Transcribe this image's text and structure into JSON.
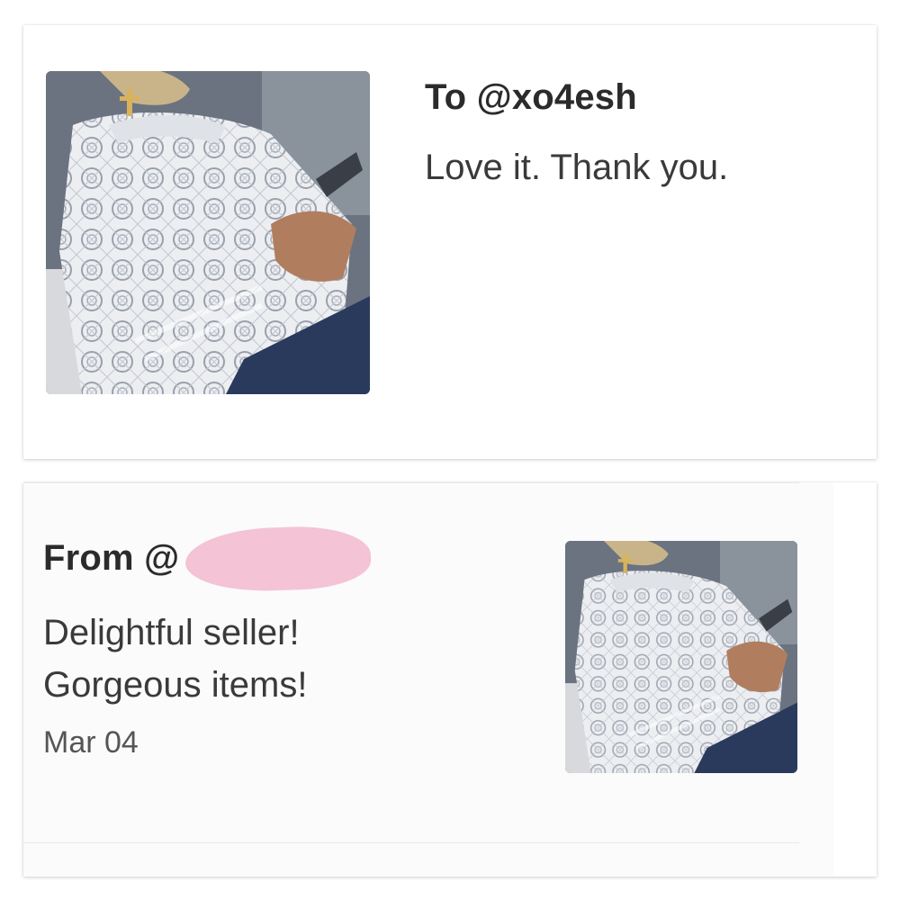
{
  "sent_review": {
    "title": "To @xo4esh",
    "message": "Love it. Thank you."
  },
  "received_review": {
    "title": "From @",
    "message_line1": "Delightful seller!",
    "message_line2": "Gorgeous items!",
    "date": "Mar 04"
  },
  "colors": {
    "redaction": "#f4c3d6",
    "lace_top": "#f3f3f5",
    "jeans": "#2a3a5c"
  }
}
